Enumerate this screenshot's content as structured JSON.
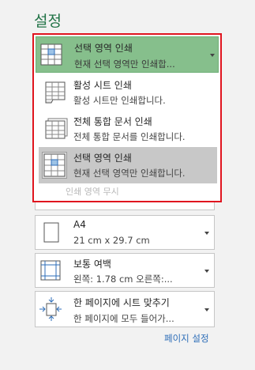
{
  "section_title": "설정",
  "dropdown": {
    "header": {
      "title": "선택 영역 인쇄",
      "subtitle": "현재 선택 영역만 인쇄합...",
      "icon": "print-selection-icon"
    },
    "items": [
      {
        "title": "활성 시트 인쇄",
        "subtitle": "활성 시트만 인쇄합니다.",
        "icon": "sheet-icon"
      },
      {
        "title": "전체 통합 문서 인쇄",
        "subtitle": "전체 통합 문서를 인쇄합니다.",
        "icon": "workbook-icon"
      },
      {
        "title": "선택 영역 인쇄",
        "subtitle": "현재 선택 영역만 인쇄합니다.",
        "icon": "print-selection-icon",
        "selected": true
      }
    ],
    "footer": "인쇄 영역 무시"
  },
  "settings": {
    "paper": {
      "title": "A4",
      "subtitle": "21 cm x 29.7 cm",
      "icon": "page-icon"
    },
    "margins": {
      "title": "보통 여백",
      "subtitle": "왼쪽:  1.78 cm     오른쪽:...",
      "icon": "margins-icon"
    },
    "scaling": {
      "title": "한 페이지에 시트 맞추기",
      "subtitle": "한 페이지에 모두 들어가...",
      "icon": "fit-to-page-icon"
    }
  },
  "page_setup_link": "페이지 설정",
  "colors": {
    "accent": "#217346",
    "highlight_border": "#e0151f",
    "selected_header": "#86bf8c"
  }
}
